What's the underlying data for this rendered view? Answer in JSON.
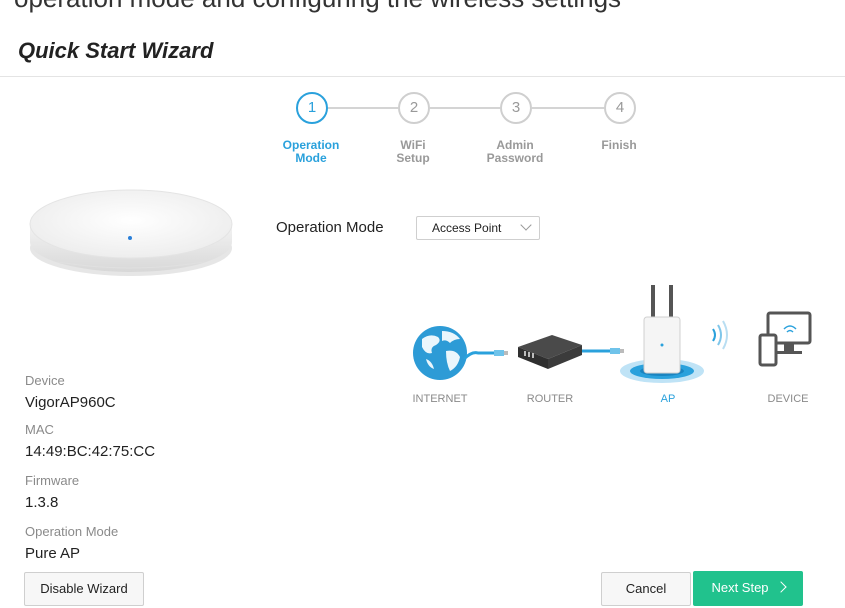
{
  "cut_header_text": "operation mode and configuring the wireless settings",
  "wizard": {
    "title": "Quick Start Wizard"
  },
  "steps": [
    {
      "number": "1",
      "label_line1": "Operation",
      "label_line2": "Mode",
      "active": true
    },
    {
      "number": "2",
      "label_line1": "WiFi",
      "label_line2": "Setup",
      "active": false
    },
    {
      "number": "3",
      "label_line1": "Admin",
      "label_line2": "Password",
      "active": false
    },
    {
      "number": "4",
      "label_line1": "Finish",
      "label_line2": "",
      "active": false
    }
  ],
  "device_info": {
    "device_label": "Device",
    "device_value": "VigorAP960C",
    "mac_label": "MAC",
    "mac_value": "14:49:BC:42:75:CC",
    "firmware_label": "Firmware",
    "firmware_value": "1.3.8",
    "opmode_label": "Operation Mode",
    "opmode_value": "Pure AP"
  },
  "operation_mode": {
    "label": "Operation Mode",
    "selected": "Access Point"
  },
  "topology": {
    "internet": "INTERNET",
    "router": "ROUTER",
    "ap": "AP",
    "device": "DEVICE"
  },
  "buttons": {
    "disable_wizard": "Disable Wizard",
    "cancel": "Cancel",
    "next_step": "Next Step"
  },
  "colors": {
    "accent": "#2aa1dc",
    "primary_button": "#21c28d",
    "inactive_step": "#cfcfcf"
  }
}
